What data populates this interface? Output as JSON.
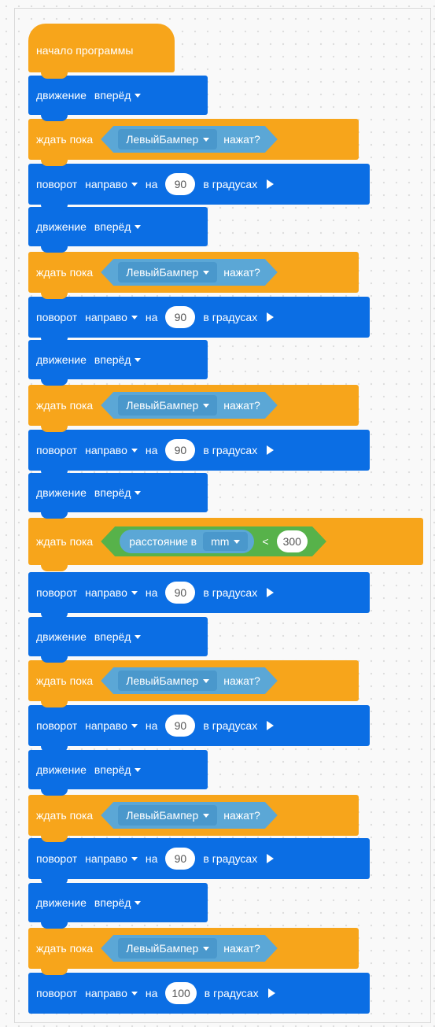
{
  "hat_label": "начало программы",
  "blocks": [
    {
      "type": "move",
      "verb": "движение",
      "dir": "вперёд"
    },
    {
      "type": "wait",
      "verb": "ждать пока",
      "sensor": "ЛевыйБампер",
      "state": "нажат?"
    },
    {
      "type": "turn",
      "verb": "поворот",
      "dir": "направо",
      "prep": "на",
      "value": "90",
      "unit": "в градусах"
    },
    {
      "type": "move",
      "verb": "движение",
      "dir": "вперёд"
    },
    {
      "type": "wait",
      "verb": "ждать пока",
      "sensor": "ЛевыйБампер",
      "state": "нажат?"
    },
    {
      "type": "turn",
      "verb": "поворот",
      "dir": "направо",
      "prep": "на",
      "value": "90",
      "unit": "в градусах"
    },
    {
      "type": "move",
      "verb": "движение",
      "dir": "вперёд"
    },
    {
      "type": "wait",
      "verb": "ждать пока",
      "sensor": "ЛевыйБампер",
      "state": "нажат?"
    },
    {
      "type": "turn",
      "verb": "поворот",
      "dir": "направо",
      "prep": "на",
      "value": "90",
      "unit": "в градусах"
    },
    {
      "type": "move",
      "verb": "движение",
      "dir": "вперёд"
    },
    {
      "type": "waitdist",
      "verb": "ждать пока",
      "sensor": "расстояние в",
      "dist_unit": "mm",
      "op": "<",
      "value": "300"
    },
    {
      "type": "turn",
      "verb": "поворот",
      "dir": "направо",
      "prep": "на",
      "value": "90",
      "unit": "в градусах"
    },
    {
      "type": "move",
      "verb": "движение",
      "dir": "вперёд"
    },
    {
      "type": "wait",
      "verb": "ждать пока",
      "sensor": "ЛевыйБампер",
      "state": "нажат?"
    },
    {
      "type": "turn",
      "verb": "поворот",
      "dir": "направо",
      "prep": "на",
      "value": "90",
      "unit": "в градусах"
    },
    {
      "type": "move",
      "verb": "движение",
      "dir": "вперёд"
    },
    {
      "type": "wait",
      "verb": "ждать пока",
      "sensor": "ЛевыйБампер",
      "state": "нажат?"
    },
    {
      "type": "turn",
      "verb": "поворот",
      "dir": "направо",
      "prep": "на",
      "value": "90",
      "unit": "в градусах"
    },
    {
      "type": "move",
      "verb": "движение",
      "dir": "вперёд"
    },
    {
      "type": "wait",
      "verb": "ждать пока",
      "sensor": "ЛевыйБампер",
      "state": "нажат?"
    },
    {
      "type": "turn",
      "verb": "поворот",
      "dir": "направо",
      "prep": "на",
      "value": "100",
      "unit": "в градусах"
    }
  ],
  "colors": {
    "motion": "#0b6ee4",
    "control": "#f7a51b",
    "sensing": "#5ba7d6",
    "operator": "#57b24a"
  },
  "icons": {
    "dropdown": "caret-down-icon",
    "run": "play-icon"
  }
}
